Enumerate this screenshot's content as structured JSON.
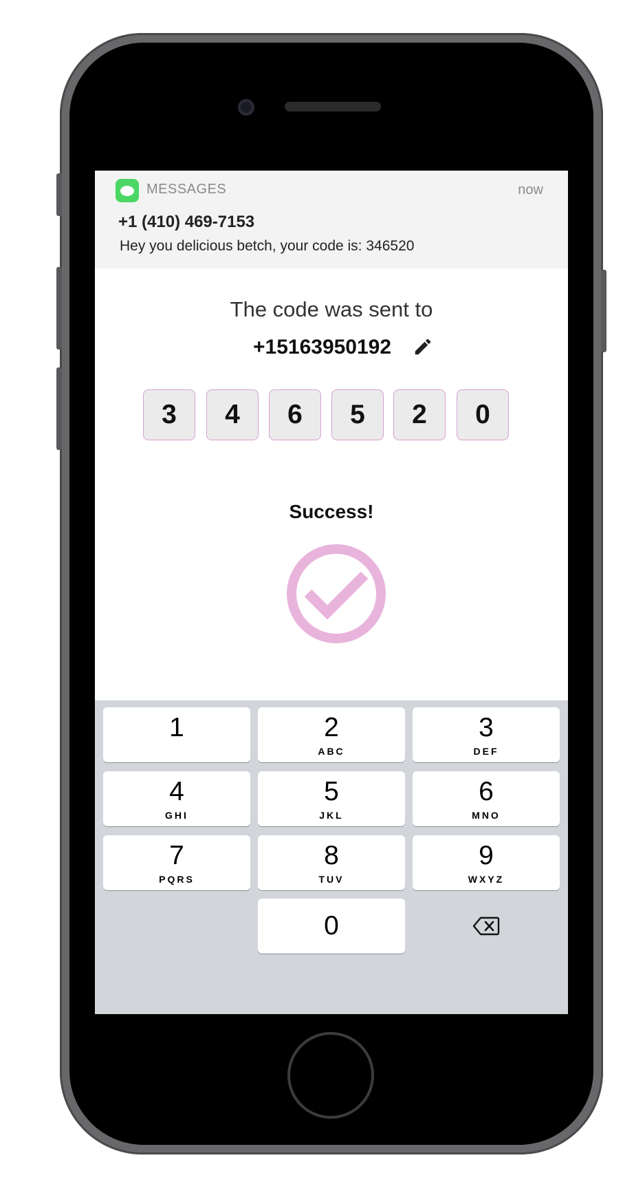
{
  "notification": {
    "app_name": "MESSAGES",
    "time": "now",
    "sender": "+1 (410) 469-7153",
    "body": "Hey you delicious betch, your code is: 346520"
  },
  "verification": {
    "sent_label": "The code was sent to",
    "phone_number": "+15163950192",
    "digits": [
      "3",
      "4",
      "6",
      "5",
      "2",
      "0"
    ],
    "status": "Success!"
  },
  "keypad": {
    "keys": [
      {
        "num": "1",
        "letters": ""
      },
      {
        "num": "2",
        "letters": "ABC"
      },
      {
        "num": "3",
        "letters": "DEF"
      },
      {
        "num": "4",
        "letters": "GHI"
      },
      {
        "num": "5",
        "letters": "JKL"
      },
      {
        "num": "6",
        "letters": "MNO"
      },
      {
        "num": "7",
        "letters": "PQRS"
      },
      {
        "num": "8",
        "letters": "TUV"
      },
      {
        "num": "9",
        "letters": "WXYZ"
      },
      {
        "num": "0",
        "letters": ""
      }
    ]
  },
  "colors": {
    "accent": "#e8b4dc",
    "messages_green": "#4bd763",
    "keypad_bg": "#d2d5da"
  },
  "icons": [
    "messages-app-icon",
    "edit-pencil-icon",
    "success-check-icon",
    "backspace-icon"
  ]
}
